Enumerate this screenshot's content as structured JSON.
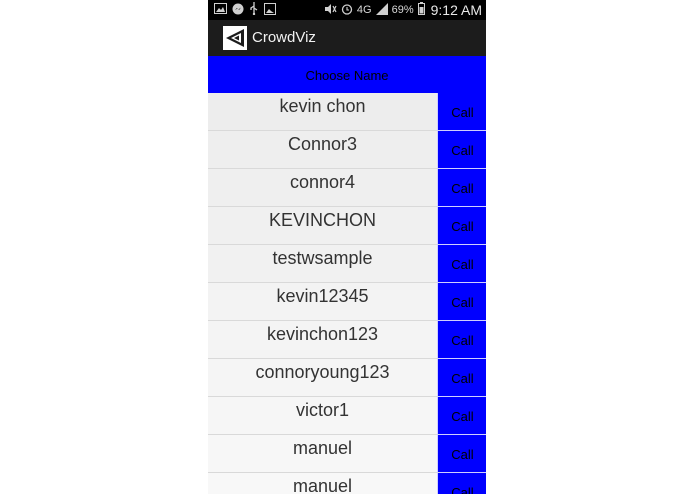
{
  "status_bar": {
    "icons": [
      "image-icon",
      "messenger-icon",
      "usb-icon",
      "screenshot-icon"
    ],
    "network": "4G",
    "battery": "69%",
    "time": "9:12 AM"
  },
  "app_bar": {
    "title": "CrowdViz"
  },
  "list_header": {
    "label": "Choose Name"
  },
  "contacts": [
    {
      "name": "kevin chon",
      "action": "Call"
    },
    {
      "name": "Connor3",
      "action": "Call"
    },
    {
      "name": "connor4",
      "action": "Call"
    },
    {
      "name": "KEVINCHON",
      "action": "Call"
    },
    {
      "name": "testwsample",
      "action": "Call"
    },
    {
      "name": "kevin12345",
      "action": "Call"
    },
    {
      "name": "kevinchon123",
      "action": "Call"
    },
    {
      "name": "connoryoung123",
      "action": "Call"
    },
    {
      "name": "victor1",
      "action": "Call"
    },
    {
      "name": "manuel",
      "action": "Call"
    },
    {
      "name": "manuel",
      "action": "Call"
    }
  ],
  "colors": {
    "header_bg": "#0000ff",
    "call_bg": "#0000ff",
    "app_bar_bg": "#1c1c1c",
    "status_bar_bg": "#000000"
  }
}
